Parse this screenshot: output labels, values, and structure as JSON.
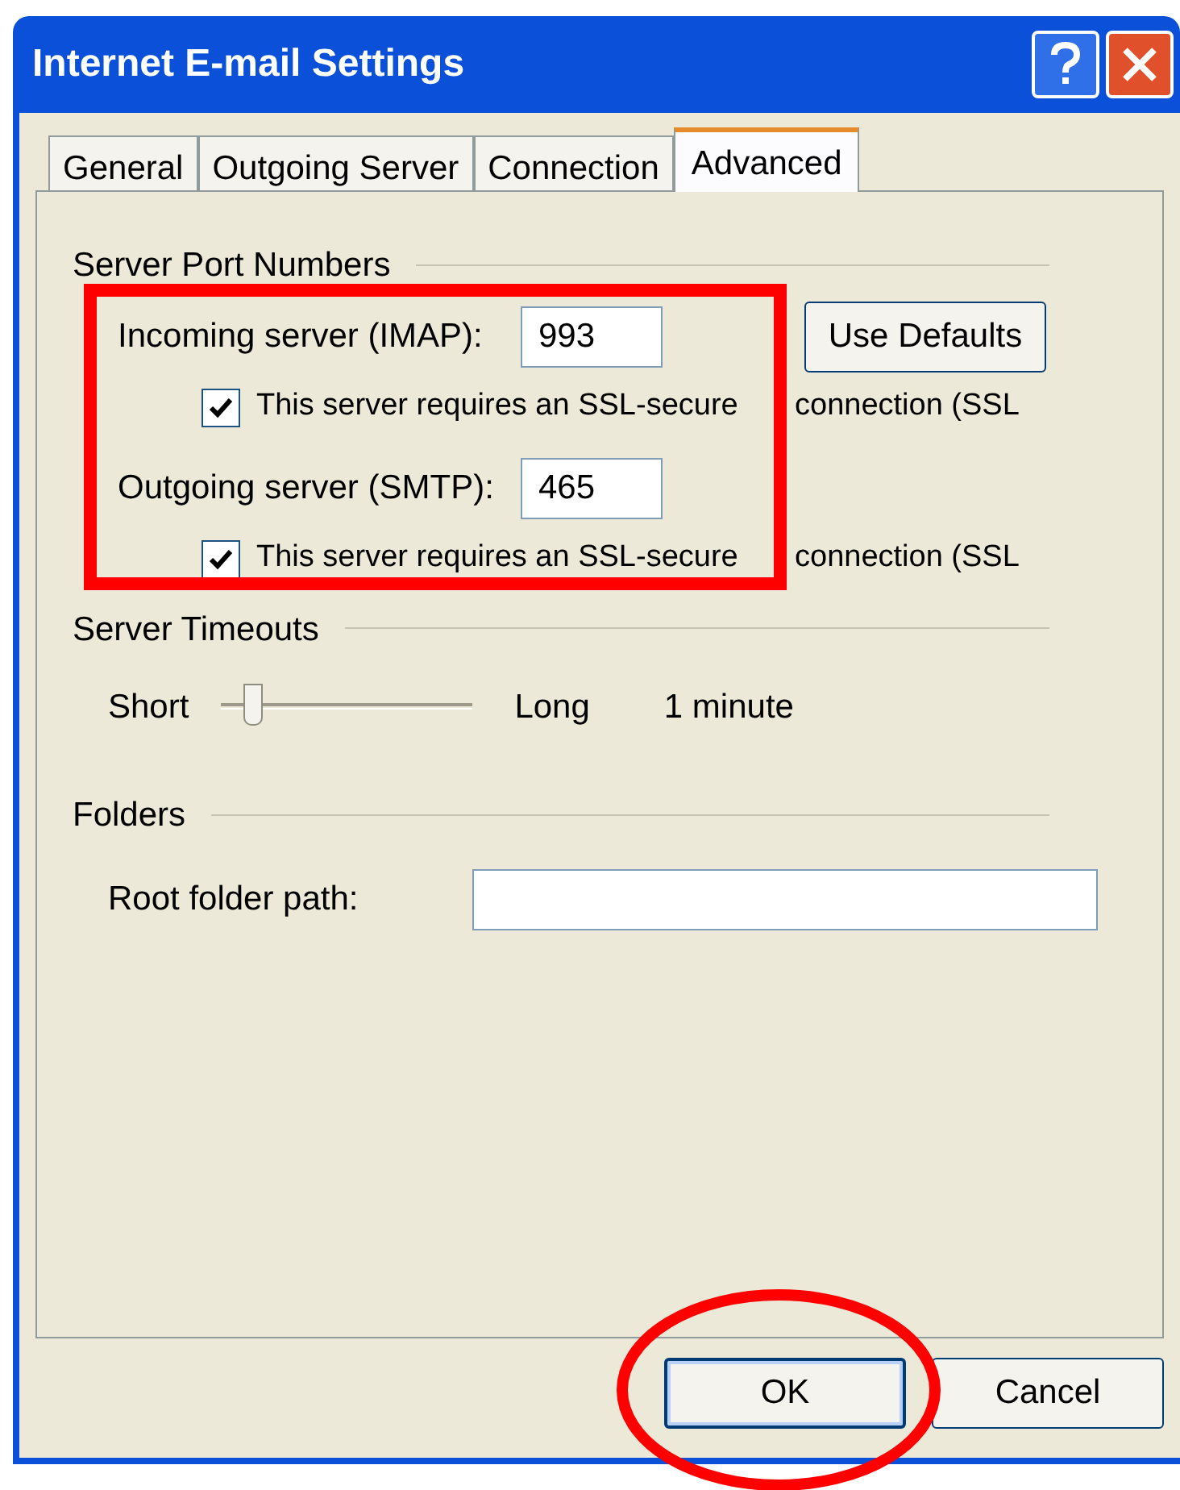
{
  "window": {
    "title": "Internet E-mail Settings",
    "title_buttons": [
      {
        "kind": "help"
      },
      {
        "kind": "close"
      }
    ]
  },
  "tabs": [
    {
      "label": "General",
      "selected": false
    },
    {
      "label": "Outgoing Server",
      "selected": false
    },
    {
      "label": "Connection",
      "selected": false
    },
    {
      "label": "Advanced",
      "selected": true
    }
  ],
  "server_ports": {
    "title": "Server Port Numbers",
    "servers": [
      {
        "label": "Incoming server (IMAP):",
        "value": "993",
        "ssl": {
          "label": "This server requires an SSL-secure",
          "label_rest": "connection (SSL",
          "checked": true
        }
      },
      {
        "label": "Outgoing server (SMTP):",
        "value": "465",
        "ssl": {
          "label": "This server requires an SSL-secure",
          "label_rest": "connection (SSL",
          "checked": true
        }
      }
    ],
    "defaults_button": {
      "label": "Use Defaults"
    }
  },
  "timeouts": {
    "title": "Server Timeouts",
    "min_label": "Short",
    "max_label": "Long",
    "level": 0.13,
    "reading": "1 minute"
  },
  "folders": {
    "title": "Folders",
    "root_path": {
      "label": "Root folder path:"
    }
  },
  "buttons": [
    {
      "label": "OK",
      "default": true
    },
    {
      "label": "Cancel",
      "default": false
    }
  ],
  "annotations": [
    {
      "kind": "rectangle",
      "color": "#ff0000"
    },
    {
      "kind": "ellipse",
      "color": "#ff0000"
    }
  ]
}
